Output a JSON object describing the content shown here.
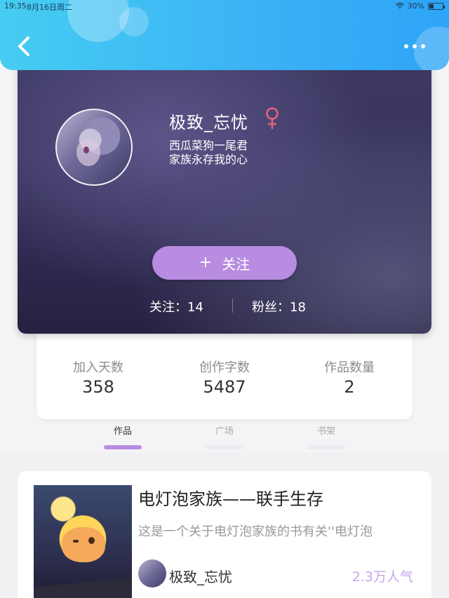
{
  "status_bar": {
    "time": "19:35",
    "date": "8月16日周二",
    "battery": "30%"
  },
  "header": {
    "back_icon": "chevron-left-icon",
    "more_icon": "more-dots-icon",
    "accent": "#3bb3f5"
  },
  "profile": {
    "username": "极致_忘忧",
    "gender_icon": "female-icon",
    "gender_color": "#e0657a",
    "bio_line1": "西瓜菜狗一尾君",
    "bio_line2": "家族永存我的心",
    "follow_button": {
      "icon": "+",
      "label": "关注",
      "color": "#b88ce0"
    },
    "following_text": "关注：14",
    "fans_text": "粉丝：18"
  },
  "stats": [
    {
      "label": "加入天数",
      "value": "358"
    },
    {
      "label": "创作字数",
      "value": "5487"
    },
    {
      "label": "作品数量",
      "value": "2"
    }
  ],
  "tabs": [
    {
      "label": "作品",
      "active": true
    },
    {
      "label": "广场",
      "active": false
    },
    {
      "label": "书架",
      "active": false
    }
  ],
  "works": [
    {
      "title": "电灯泡家族——联手生存",
      "description": "这是一个关于电灯泡家族的书有关''电灯泡",
      "author": "极致_忘忧",
      "popularity": "2.3万人气"
    }
  ]
}
